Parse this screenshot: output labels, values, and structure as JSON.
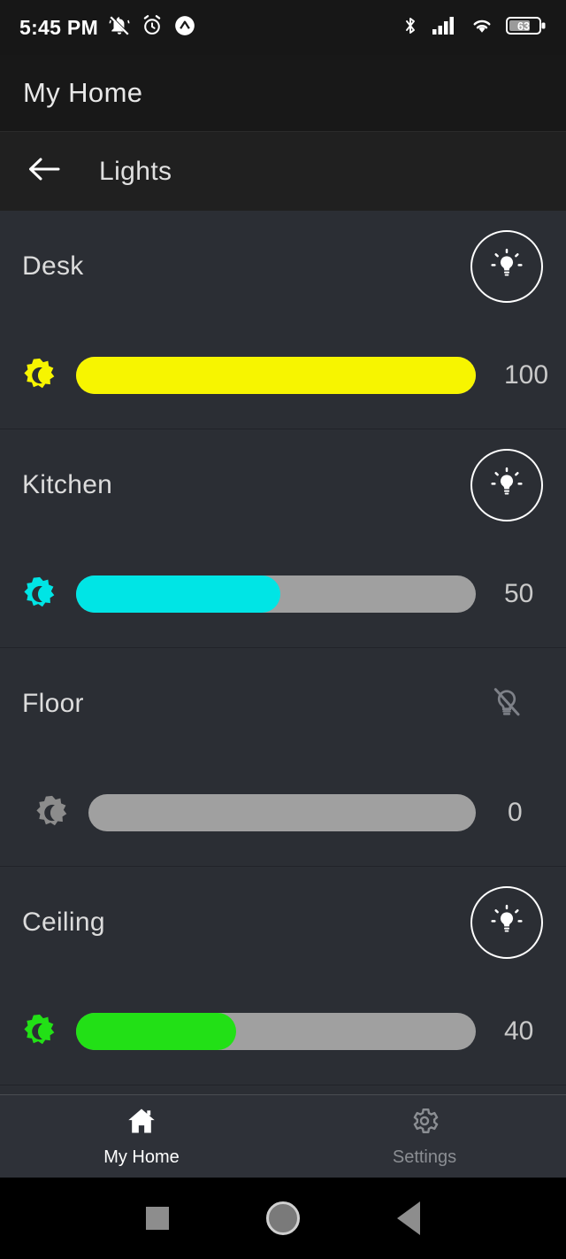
{
  "status_bar": {
    "time": "5:45 PM",
    "battery_percent": "63",
    "icons": [
      "vibrate-off-icon",
      "alarm-icon",
      "circle-caret-icon",
      "bluetooth-icon",
      "cell-signal-icon",
      "wifi-icon",
      "battery-icon"
    ]
  },
  "app_bar": {
    "title": "My Home"
  },
  "sub_header": {
    "title": "Lights",
    "back_icon": "back-arrow-icon"
  },
  "lights": [
    {
      "name": "Desk",
      "value": "100",
      "percent": 100,
      "color": "#f7f500",
      "on": true,
      "power_icon": "bulb-on-icon",
      "brightness_icon": "brightness-icon"
    },
    {
      "name": "Kitchen",
      "value": "50",
      "percent": 50,
      "color": "#00e5e5",
      "on": true,
      "power_icon": "bulb-on-icon",
      "brightness_icon": "brightness-icon"
    },
    {
      "name": "Floor",
      "value": "0",
      "percent": 0,
      "color": "#8c8c8c",
      "on": false,
      "power_icon": "bulb-off-icon",
      "brightness_icon": "brightness-icon"
    },
    {
      "name": "Ceiling",
      "value": "40",
      "percent": 40,
      "color": "#22e016",
      "on": true,
      "power_icon": "bulb-on-icon",
      "brightness_icon": "brightness-icon"
    }
  ],
  "bottom_nav": {
    "items": [
      {
        "label": "My Home",
        "icon": "home-icon",
        "active": true
      },
      {
        "label": "Settings",
        "icon": "gear-icon",
        "active": false
      }
    ]
  },
  "system_nav": {
    "icons": [
      "recents-square-icon",
      "home-circle-icon",
      "back-triangle-icon"
    ]
  },
  "colors": {
    "background": "#2b2e34",
    "app_bar": "#181818",
    "sub_bar": "#202020",
    "track": "#a0a0a0",
    "nav_bar": "#2e3138"
  }
}
